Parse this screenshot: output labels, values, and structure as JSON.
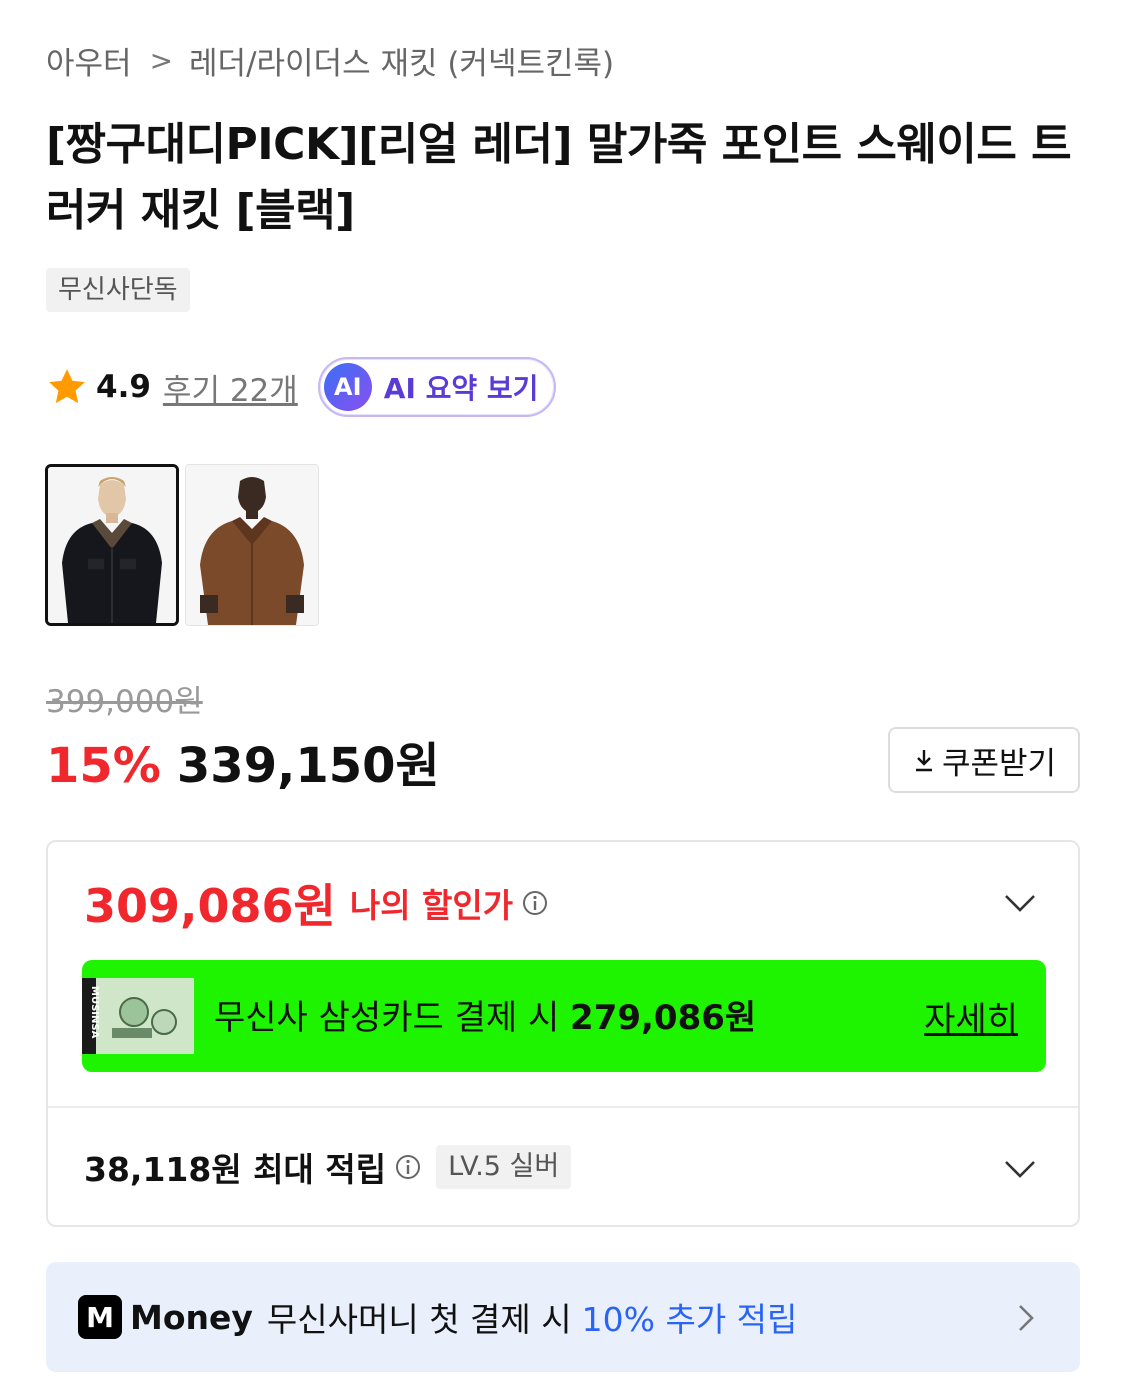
{
  "breadcrumb": {
    "category": "아우터",
    "separator": ">",
    "subcategory": "레더/라이더스 재킷 (커넥트킨록)"
  },
  "product": {
    "title": "[짱구대디PICK][리얼 레더] 말가죽 포인트 스웨이드 트러커 재킷 [블랙]",
    "exclusive_badge": "무신사단독",
    "rating": "4.9",
    "reviews_label": "후기 22개",
    "ai_icon_text": "AI",
    "ai_summary_label": "AI 요약 보기"
  },
  "price": {
    "original": "399,000원",
    "discount_rate": "15%",
    "sale": "339,150원",
    "coupon_label": "쿠폰받기"
  },
  "my_discount": {
    "price": "309,086원",
    "label": "나의 할인가"
  },
  "card_promo": {
    "text_prefix": "무신사 삼성카드 결제 시",
    "amount": "279,086원",
    "link": "자세히",
    "card_brand": "MUSINSA"
  },
  "points": {
    "text": "38,118원 최대 적립",
    "level": "LV.5 실버"
  },
  "money_promo": {
    "logo": "M",
    "brand": "Money",
    "text": "무신사머니 첫 결제 시",
    "highlight": "10% 추가 적립"
  },
  "colors": {
    "accent_red": "#f0282d",
    "card_green": "#1ef300",
    "money_blue": "#2a64f5",
    "ai_purple": "#5a3bd6"
  },
  "icons": {
    "rating": "star-icon",
    "download": "download-icon",
    "info": "info-icon",
    "expand": "chevron-down-icon",
    "forward": "chevron-right-icon"
  }
}
